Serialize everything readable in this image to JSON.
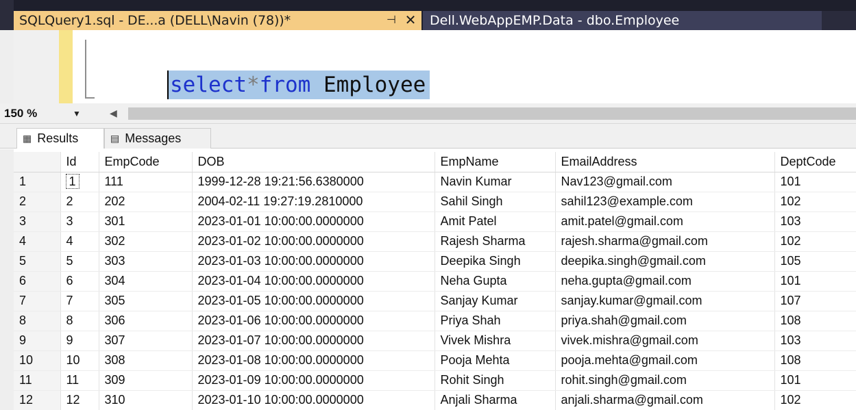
{
  "tabs": {
    "active": {
      "title": "SQLQuery1.sql - DE...a (DELL\\Navin (78))*",
      "pin_glyph": "⊣",
      "close_glyph": "✕"
    },
    "inactive": {
      "title": "Dell.WebAppEMP.Data - dbo.Employee"
    }
  },
  "editor": {
    "tokens": {
      "select": "select",
      "star": "*",
      "from": "from",
      "space": " ",
      "table": "Employee"
    }
  },
  "zoom": {
    "value": "150 %"
  },
  "results": {
    "tab_results": "Results",
    "tab_messages": "Messages",
    "columns": [
      "Id",
      "EmpCode",
      "DOB",
      "EmpName",
      "EmailAddress",
      "DeptCode"
    ],
    "rows": [
      [
        "1",
        "1",
        "111",
        "1999-12-28 19:21:56.6380000",
        "Navin Kumar",
        "Nav123@gmail.com",
        "101"
      ],
      [
        "2",
        "2",
        "202",
        "2004-02-11 19:27:19.2810000",
        "Sahil Singh",
        "sahil123@example.com",
        "102"
      ],
      [
        "3",
        "3",
        "301",
        "2023-01-01 10:00:00.0000000",
        "Amit Patel",
        "amit.patel@gmail.com",
        "103"
      ],
      [
        "4",
        "4",
        "302",
        "2023-01-02 10:00:00.0000000",
        "Rajesh Sharma",
        "rajesh.sharma@gmail.com",
        "102"
      ],
      [
        "5",
        "5",
        "303",
        "2023-01-03 10:00:00.0000000",
        "Deepika Singh",
        "deepika.singh@gmail.com",
        "105"
      ],
      [
        "6",
        "6",
        "304",
        "2023-01-04 10:00:00.0000000",
        "Neha Gupta",
        "neha.gupta@gmail.com",
        "101"
      ],
      [
        "7",
        "7",
        "305",
        "2023-01-05 10:00:00.0000000",
        "Sanjay Kumar",
        "sanjay.kumar@gmail.com",
        "107"
      ],
      [
        "8",
        "8",
        "306",
        "2023-01-06 10:00:00.0000000",
        "Priya Shah",
        "priya.shah@gmail.com",
        "108"
      ],
      [
        "9",
        "9",
        "307",
        "2023-01-07 10:00:00.0000000",
        "Vivek Mishra",
        "vivek.mishra@gmail.com",
        "103"
      ],
      [
        "10",
        "10",
        "308",
        "2023-01-08 10:00:00.0000000",
        "Pooja Mehta",
        "pooja.mehta@gmail.com",
        "108"
      ],
      [
        "11",
        "11",
        "309",
        "2023-01-09 10:00:00.0000000",
        "Rohit Singh",
        "rohit.singh@gmail.com",
        "101"
      ],
      [
        "12",
        "12",
        "310",
        "2023-01-10 10:00:00.0000000",
        "Anjali Sharma",
        "anjali.sharma@gmail.com",
        "102"
      ]
    ]
  },
  "colors": {
    "active_tab": "#f5cc84",
    "inactive_tab": "#3d3f5a",
    "title_bar": "#1e1f2c",
    "keyword": "#1d32cc",
    "selection": "#a8c8e8"
  },
  "icons": {
    "results_tab": "grid-icon",
    "messages_tab": "messages-icon"
  }
}
